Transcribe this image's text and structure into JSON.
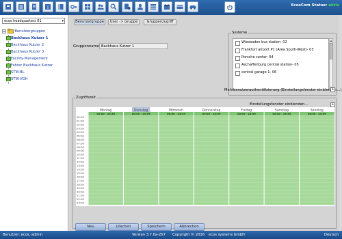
{
  "toolbar": {
    "icons": [
      "user-card-icon",
      "list-icon",
      "document-icon",
      "info-icon",
      "book-icon",
      "key-icon",
      "grid-icon",
      "people-icon",
      "search-key-icon",
      "doc-person-icon",
      "person-icon",
      "cabinet-icon",
      "calendar-icon",
      "card-icon",
      "car-icon"
    ],
    "power_icon": "power-icon",
    "status_label": "EcosCom Status:",
    "status_value": "aktiv",
    "status_color": "#49e04b"
  },
  "sidebar": {
    "site": "ecos headquarters 01",
    "root": {
      "label": "Benutzergruppen",
      "icon": "folder-group-icon"
    },
    "items": [
      {
        "label": "Backhaus Kutzer 1",
        "selected": true
      },
      {
        "label": "Backhaus Kutzer 2",
        "selected": false
      },
      {
        "label": "Backhaus Kutzer 3",
        "selected": false
      },
      {
        "label": "Facility-Management",
        "selected": false
      },
      {
        "label": "Fahrer Backhaus Kutzer",
        "selected": false
      },
      {
        "label": "STW-BL",
        "selected": false
      },
      {
        "label": "STW-VGH",
        "selected": false
      }
    ]
  },
  "tabs": [
    {
      "label": "Benutzergruppe",
      "active": true
    },
    {
      "label": "User -> Gruppe",
      "active": false
    },
    {
      "label": "Gruppenzugriff",
      "active": false
    }
  ],
  "form": {
    "group_name_label": "Gruppenname",
    "group_name_value": "Backhaus Kutzer 1"
  },
  "systems": {
    "legend": "Systeme",
    "items": [
      "Wiesbaden bus station- 02",
      "Frankfurt airport P1 (Area South-West)- 03",
      "Porsche center- 04",
      "Aschaffenburg central station- 05",
      "central garage 1- 06"
    ]
  },
  "multi_auth": {
    "label": "Mehrbenutzerauthentifizierung (Einstellungsfenster einblenden...)",
    "toggle": "+"
  },
  "access": {
    "legend": "Zugriffszeit",
    "settings_label": "Einstellungsfenster einblenden...",
    "settings_toggle": "+",
    "days": [
      {
        "label": "Montag",
        "range": "00:00 - 23:59",
        "highlighted": false
      },
      {
        "label": "Dienstag",
        "range": "00:00 - 23:59",
        "highlighted": true
      },
      {
        "label": "Mittwoch",
        "range": "00:00 - 23:59",
        "highlighted": false
      },
      {
        "label": "Donnerstag",
        "range": "00:00 - 23:59",
        "highlighted": false
      },
      {
        "label": "Freitag",
        "range": "00:00 - 23:59",
        "highlighted": false
      },
      {
        "label": "Samstag",
        "range": "00:00 - 23:59",
        "highlighted": false
      },
      {
        "label": "Sonntag",
        "range": "00:00 - 23:59",
        "highlighted": false
      }
    ],
    "times": [
      "00:00",
      "01:00",
      "02:00",
      "03:00",
      "04:00",
      "05:00",
      "06:00",
      "07:00",
      "08:00",
      "09:00",
      "10:00",
      "11:00",
      "12:00",
      "13:00",
      "14:00",
      "15:00",
      "16:00",
      "17:00",
      "18:00",
      "19:00",
      "20:00",
      "21:00",
      "22:00",
      "23:00"
    ],
    "fill_color": "#a6d99a",
    "header_color": "#7dc472"
  },
  "buttons": {
    "new": "Neu",
    "delete": "Löschen",
    "save": "Speichern",
    "cancel": "Abbrechen"
  },
  "statusbar": {
    "user": "Benutzer: ecos, admin",
    "version": "Version 3.7.0a-257",
    "copyright": "Copyright © 2016",
    "company": "ecos systems GmbH",
    "language": "Deutsch"
  }
}
